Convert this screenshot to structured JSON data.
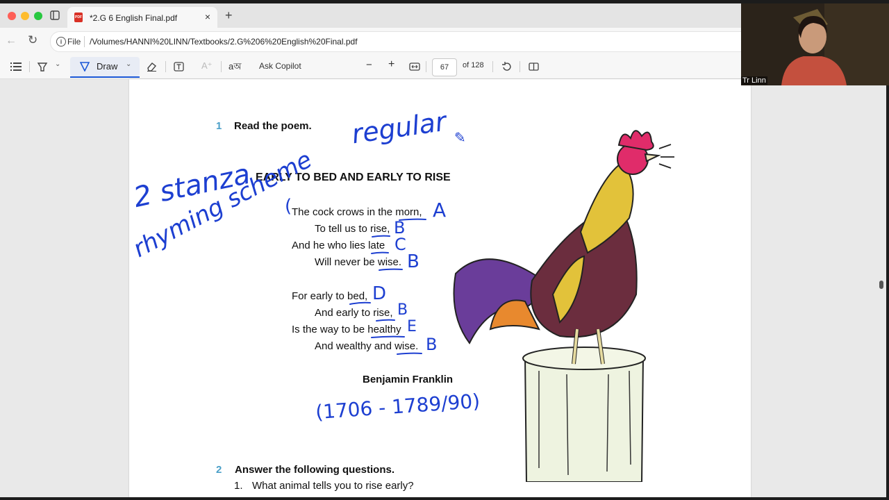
{
  "browser": {
    "tab_title": "*2.G 6 English Final.pdf",
    "tab_close": "×",
    "new_tab": "+",
    "scheme_label": "File",
    "url": "/Volumes/HANNI%20LINN/Textbooks/2.G%206%20English%20Final.pdf"
  },
  "toolbar": {
    "draw_label": "Draw",
    "ask_copilot_label": "Ask Copilot",
    "zoom_out": "−",
    "zoom_in": "+",
    "page_current": "67",
    "page_total": "of 128"
  },
  "document": {
    "section1_number": "1",
    "section1_title": "Read the poem.",
    "poem_title": "EARLY TO BED AND EARLY TO RISE",
    "stanza1": [
      "The cock crows in the morn,",
      "To tell us to rise,",
      "And he who lies late",
      "Will never be wise."
    ],
    "stanza2": [
      "For early to bed,",
      "And early to rise,",
      "Is the way to be healthy",
      "And wealthy and wise."
    ],
    "author": "Benjamin Franklin",
    "section2_number": "2",
    "section2_title": "Answer the following questions.",
    "question1_number": "1.",
    "question1_text": "What animal tells you to rise early?"
  },
  "annotations": {
    "regular": "regular",
    "stanza": "2 stanza",
    "rhyming": "rhyming scheme",
    "bracket": "(",
    "letters": [
      "A",
      "B",
      "C",
      "B",
      "D",
      "B",
      "E",
      "B"
    ],
    "dates": "(1706 - 1789/90)"
  },
  "webcam": {
    "name": "Tr Linn"
  }
}
